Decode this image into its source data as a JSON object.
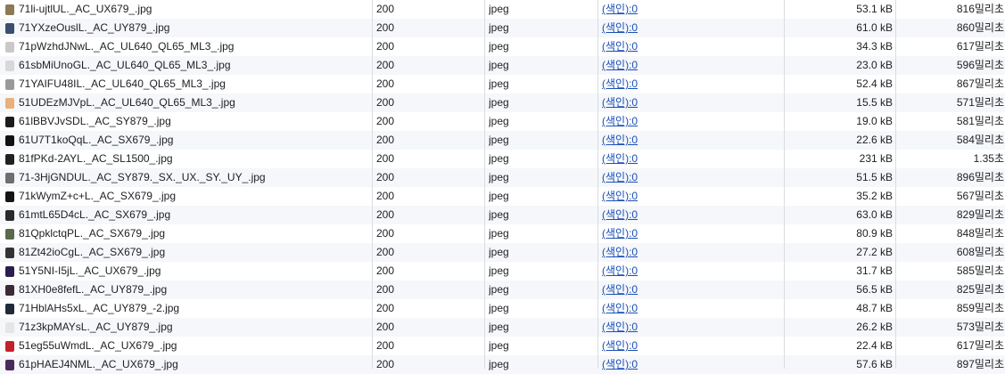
{
  "rows": [
    {
      "name": "71li-ujtlUL._AC_UX679_.jpg",
      "status": "200",
      "type": "jpeg",
      "initiator": "(색인):0",
      "size": "53.1 kB",
      "time": "816밀리초",
      "thumb_color": "#8b7a55"
    },
    {
      "name": "71YXzeOuslL._AC_UY879_.jpg",
      "status": "200",
      "type": "jpeg",
      "initiator": "(색인):0",
      "size": "61.0 kB",
      "time": "860밀리초",
      "thumb_color": "#3a4f6e"
    },
    {
      "name": "71pWzhdJNwL._AC_UL640_QL65_ML3_.jpg",
      "status": "200",
      "type": "jpeg",
      "initiator": "(색인):0",
      "size": "34.3 kB",
      "time": "617밀리초",
      "thumb_color": "#c9c9c9"
    },
    {
      "name": "61sbMiUnoGL._AC_UL640_QL65_ML3_.jpg",
      "status": "200",
      "type": "jpeg",
      "initiator": "(색인):0",
      "size": "23.0 kB",
      "time": "596밀리초",
      "thumb_color": "#d8d8d8"
    },
    {
      "name": "71YAIFU48IL._AC_UL640_QL65_ML3_.jpg",
      "status": "200",
      "type": "jpeg",
      "initiator": "(색인):0",
      "size": "52.4 kB",
      "time": "867밀리초",
      "thumb_color": "#9a9a9a"
    },
    {
      "name": "51UDEzMJVpL._AC_UL640_QL65_ML3_.jpg",
      "status": "200",
      "type": "jpeg",
      "initiator": "(색인):0",
      "size": "15.5 kB",
      "time": "571밀리초",
      "thumb_color": "#e8b07a"
    },
    {
      "name": "61lBBVJvSDL._AC_SY879_.jpg",
      "status": "200",
      "type": "jpeg",
      "initiator": "(색인):0",
      "size": "19.0 kB",
      "time": "581밀리초",
      "thumb_color": "#1c1c1c"
    },
    {
      "name": "61U7T1koQqL._AC_SX679_.jpg",
      "status": "200",
      "type": "jpeg",
      "initiator": "(색인):0",
      "size": "22.6 kB",
      "time": "584밀리초",
      "thumb_color": "#111111"
    },
    {
      "name": "81fPKd-2AYL._AC_SL1500_.jpg",
      "status": "200",
      "type": "jpeg",
      "initiator": "(색인):0",
      "size": "231 kB",
      "time": "1.35초",
      "thumb_color": "#222222"
    },
    {
      "name": "71-3HjGNDUL._AC_SY879._SX._UX._SY._UY_.jpg",
      "status": "200",
      "type": "jpeg",
      "initiator": "(색인):0",
      "size": "51.5 kB",
      "time": "896밀리초",
      "thumb_color": "#6e6e6e"
    },
    {
      "name": "71kWymZ+c+L._AC_SX679_.jpg",
      "status": "200",
      "type": "jpeg",
      "initiator": "(색인):0",
      "size": "35.2 kB",
      "time": "567밀리초",
      "thumb_color": "#151515"
    },
    {
      "name": "61mtL65D4cL._AC_SX679_.jpg",
      "status": "200",
      "type": "jpeg",
      "initiator": "(색인):0",
      "size": "63.0 kB",
      "time": "829밀리초",
      "thumb_color": "#2a2a2a"
    },
    {
      "name": "81QpklctqPL._AC_SX679_.jpg",
      "status": "200",
      "type": "jpeg",
      "initiator": "(색인):0",
      "size": "80.9 kB",
      "time": "848밀리초",
      "thumb_color": "#5a6a4a"
    },
    {
      "name": "81Zt42ioCgL._AC_SX679_.jpg",
      "status": "200",
      "type": "jpeg",
      "initiator": "(색인):0",
      "size": "27.2 kB",
      "time": "608밀리초",
      "thumb_color": "#333333"
    },
    {
      "name": "51Y5NI-I5jL._AC_UX679_.jpg",
      "status": "200",
      "type": "jpeg",
      "initiator": "(색인):0",
      "size": "31.7 kB",
      "time": "585밀리초",
      "thumb_color": "#2b1f4f"
    },
    {
      "name": "81XH0e8fefL._AC_UY879_.jpg",
      "status": "200",
      "type": "jpeg",
      "initiator": "(색인):0",
      "size": "56.5 kB",
      "time": "825밀리초",
      "thumb_color": "#3a2a3a"
    },
    {
      "name": "71HblAHs5xL._AC_UY879_-2.jpg",
      "status": "200",
      "type": "jpeg",
      "initiator": "(색인):0",
      "size": "48.7 kB",
      "time": "859밀리초",
      "thumb_color": "#1f2a3a"
    },
    {
      "name": "71z3kpMAYsL._AC_UY879_.jpg",
      "status": "200",
      "type": "jpeg",
      "initiator": "(색인):0",
      "size": "26.2 kB",
      "time": "573밀리초",
      "thumb_color": "#e6e6e6"
    },
    {
      "name": "51eg55uWmdL._AC_UX679_.jpg",
      "status": "200",
      "type": "jpeg",
      "initiator": "(색인):0",
      "size": "22.4 kB",
      "time": "617밀리초",
      "thumb_color": "#c4212a"
    },
    {
      "name": "61pHAEJ4NML._AC_UX679_.jpg",
      "status": "200",
      "type": "jpeg",
      "initiator": "(색인):0",
      "size": "57.6 kB",
      "time": "897밀리초",
      "thumb_color": "#4a2a5a"
    }
  ]
}
